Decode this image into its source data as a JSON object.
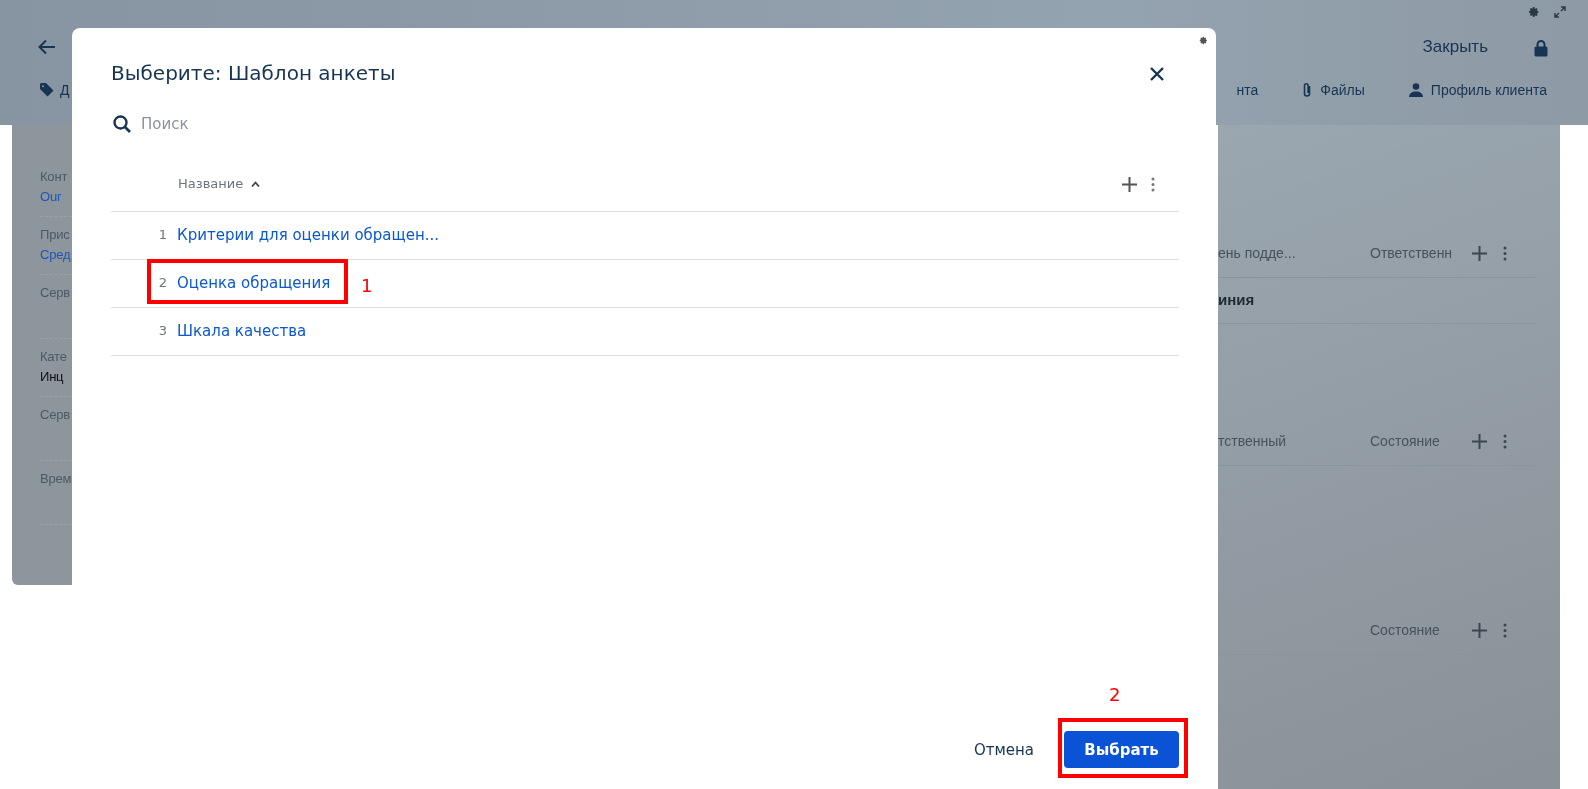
{
  "background": {
    "close_link": "Закрыть",
    "left_tabs": [
      {
        "label": "Д"
      }
    ],
    "right_tabs": [
      {
        "label": "нта"
      },
      {
        "label": "Файлы"
      },
      {
        "label": "Профиль клиента"
      }
    ],
    "fields": [
      {
        "label": "Конт",
        "value": "Our",
        "kind": "link"
      },
      {
        "label": "Прис",
        "value": "Сред",
        "kind": "link"
      },
      {
        "label": "Серв",
        "kind": "empty"
      },
      {
        "label": "Кате",
        "value": "Инц",
        "kind": "text"
      },
      {
        "label": "Серв",
        "kind": "empty"
      },
      {
        "label": "Врем",
        "kind": "empty"
      }
    ],
    "tables": [
      {
        "columns": [
          "ень подде...",
          "Ответственн"
        ],
        "rows": [
          "иния"
        ]
      },
      {
        "columns": [
          "тственный",
          "Состояние"
        ]
      },
      {
        "columns": [
          "Состояние"
        ]
      }
    ]
  },
  "dialog": {
    "title": "Выберите: Шаблон анкеты",
    "search": {
      "placeholder": "Поиск"
    },
    "table": {
      "columns": [
        {
          "label": "Название",
          "sort_ascending": true
        }
      ],
      "rows": [
        {
          "number": "1",
          "name": "Критерии для оценки обращен..."
        },
        {
          "number": "2",
          "name": "Оценка обращения"
        },
        {
          "number": "3",
          "name": "Шкала качества"
        }
      ]
    },
    "buttons": [
      {
        "label": "Отмена",
        "kind": "secondary"
      },
      {
        "label": "Выбрать",
        "kind": "primary"
      }
    ]
  },
  "annotations": [
    {
      "label": "1"
    },
    {
      "label": "2"
    }
  ]
}
